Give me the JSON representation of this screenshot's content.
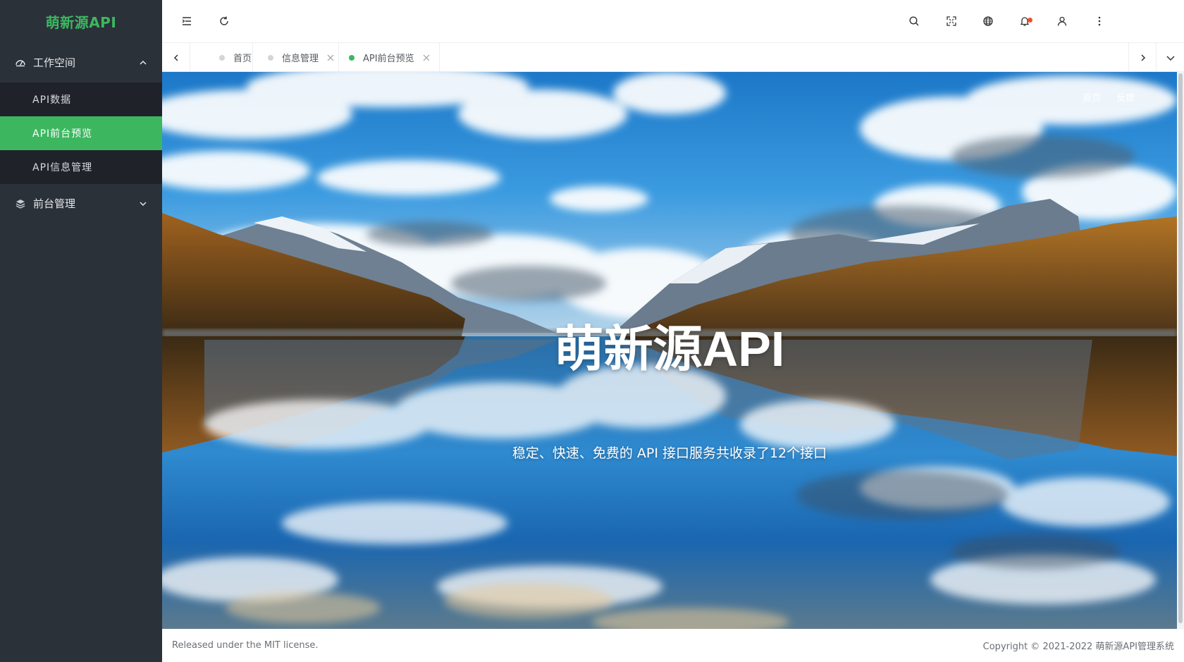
{
  "sidebar": {
    "logo": "萌新源API",
    "groups": [
      {
        "label": "工作空间",
        "icon": "gauge-icon",
        "expanded": true,
        "items": [
          {
            "label": "API数据",
            "active": false
          },
          {
            "label": "API前台预览",
            "active": true
          },
          {
            "label": "API信息管理",
            "active": false
          }
        ]
      },
      {
        "label": "前台管理",
        "icon": "layers-icon",
        "expanded": false,
        "items": []
      }
    ]
  },
  "header": {
    "icons": [
      "menu-fold-icon",
      "refresh-icon",
      "search-icon",
      "fullscreen-icon",
      "globe-icon",
      "bell-icon",
      "user-icon",
      "more-icon"
    ],
    "has_notification": true
  },
  "tabs": [
    {
      "label": "首页",
      "active": false,
      "closable": false
    },
    {
      "label": "信息管理",
      "active": false,
      "closable": true
    },
    {
      "label": "API前台预览",
      "active": true,
      "closable": true
    }
  ],
  "hero": {
    "links": [
      "首页",
      "反馈"
    ],
    "title": "萌新源API",
    "subtitle": "稳定、快速、免费的 API 接口服务共收录了12个接口"
  },
  "footer": {
    "left": "Released under the MIT license.",
    "right": "Copyright © 2021-2022 萌新源API管理系统"
  },
  "colors": {
    "accent": "#3cb760",
    "sidebar_bg": "#2b3138",
    "submenu_bg": "#1f2329",
    "notification_dot": "#f0502d"
  }
}
